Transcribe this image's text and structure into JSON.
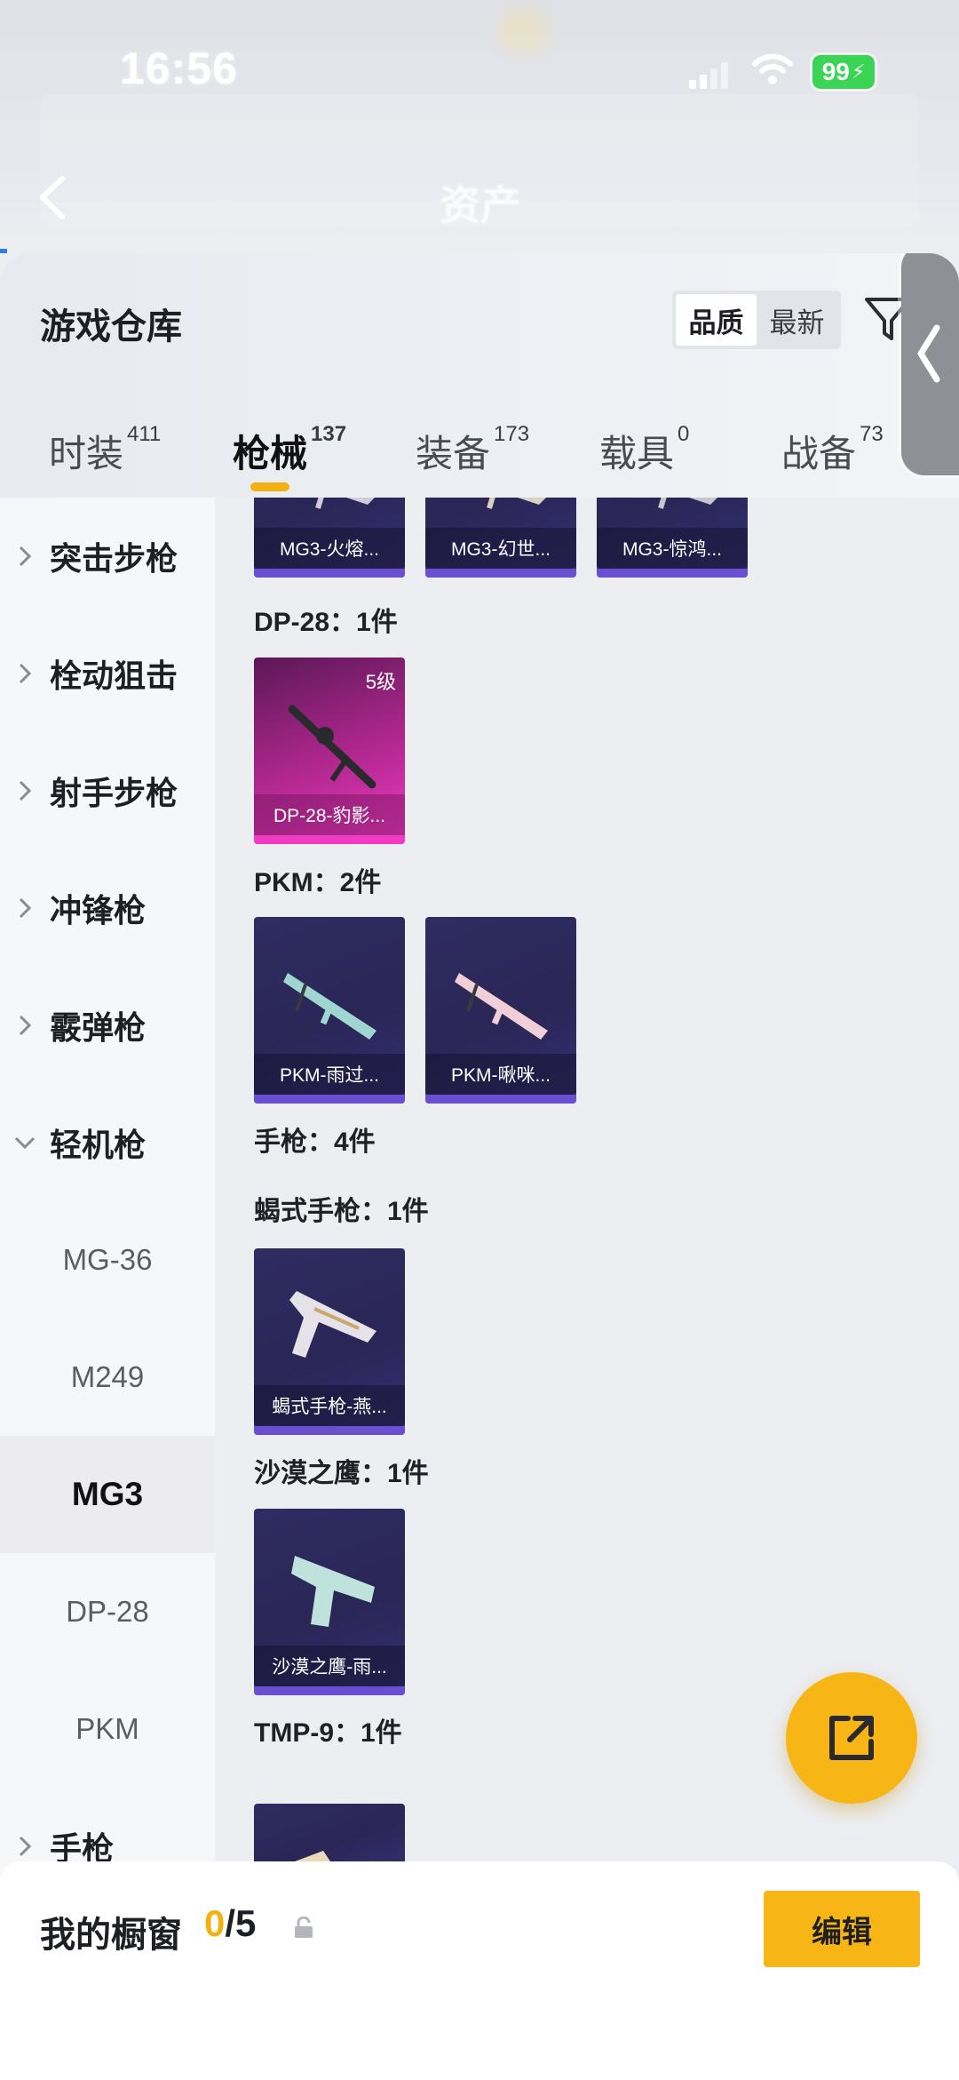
{
  "status": {
    "time": "16:56",
    "battery": "99"
  },
  "nav": {
    "title": "资产"
  },
  "sheet": {
    "title": "游戏仓库",
    "sort": {
      "quality": "品质",
      "latest": "最新"
    }
  },
  "tabs": [
    {
      "label": "时装",
      "count": "411"
    },
    {
      "label": "枪械",
      "count": "137"
    },
    {
      "label": "装备",
      "count": "173"
    },
    {
      "label": "载具",
      "count": "0"
    },
    {
      "label": "战备",
      "count": "73"
    }
  ],
  "sidebar": {
    "categories": [
      "突击步枪",
      "栓动狙击",
      "射手步枪",
      "冲锋枪",
      "霰弹枪",
      "轻机枪",
      "手枪"
    ],
    "subitems": [
      "MG-36",
      "M249",
      "MG3",
      "DP-28",
      "PKM"
    ]
  },
  "groups": {
    "mg3": {
      "cards": [
        "MG3-火熔...",
        "MG3-幻世...",
        "MG3-惊鸿..."
      ]
    },
    "dp28": {
      "label": "DP-28：1件",
      "card": "DP-28-豹影...",
      "level": "5级"
    },
    "pkm": {
      "label": "PKM：2件",
      "cards": [
        "PKM-雨过...",
        "PKM-啾咪..."
      ]
    },
    "pistols": {
      "label": "手枪：4件"
    },
    "scorpion": {
      "label": "蝎式手枪：1件",
      "card": "蝎式手枪-燕..."
    },
    "deagle": {
      "label": "沙漠之鹰：1件",
      "card": "沙漠之鹰-雨..."
    },
    "tmp9": {
      "label": "TMP-9：1件"
    }
  },
  "bottom": {
    "label": "我的橱窗",
    "current": "0",
    "total": "/5",
    "edit": "编辑"
  },
  "colors": {
    "accent": "#f7b516",
    "battery": "#3bd454",
    "card_bg": "#2f2c63",
    "card_purple": "#b0278e"
  }
}
